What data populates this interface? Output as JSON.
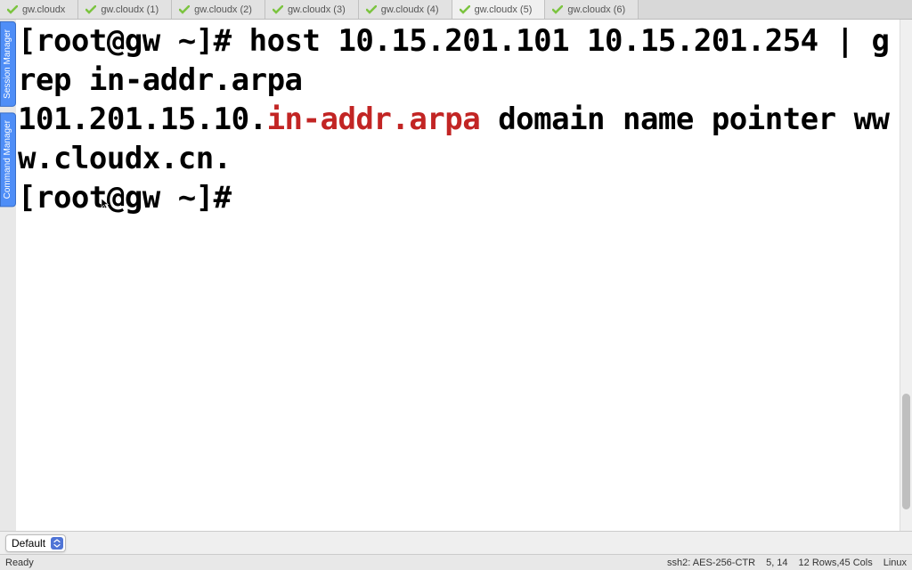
{
  "side_tabs": {
    "session": "Session Manager",
    "command": "Command Manager"
  },
  "tabs": [
    {
      "label": "gw.cloudx"
    },
    {
      "label": "gw.cloudx (1)"
    },
    {
      "label": "gw.cloudx (2)"
    },
    {
      "label": "gw.cloudx (3)"
    },
    {
      "label": "gw.cloudx (4)"
    },
    {
      "label": "gw.cloudx (5)",
      "active": true
    },
    {
      "label": "gw.cloudx (6)"
    }
  ],
  "terminal": {
    "line1": "[root@gw ~]# host 10.15.201.101 10.15.201.254 | grep in-addr.arpa",
    "line2_a": "101.201.15.10.",
    "line2_b": "in-addr.arpa",
    "line2_c": " domain name pointer www.cloudx.cn.",
    "line3": "[root@gw ~]# "
  },
  "bottom": {
    "select_value": "Default"
  },
  "status": {
    "ready": "Ready",
    "conn": "ssh2: AES-256-CTR",
    "pos": "5, 14",
    "size": "12 Rows,45 Cols",
    "os": "Linux"
  }
}
